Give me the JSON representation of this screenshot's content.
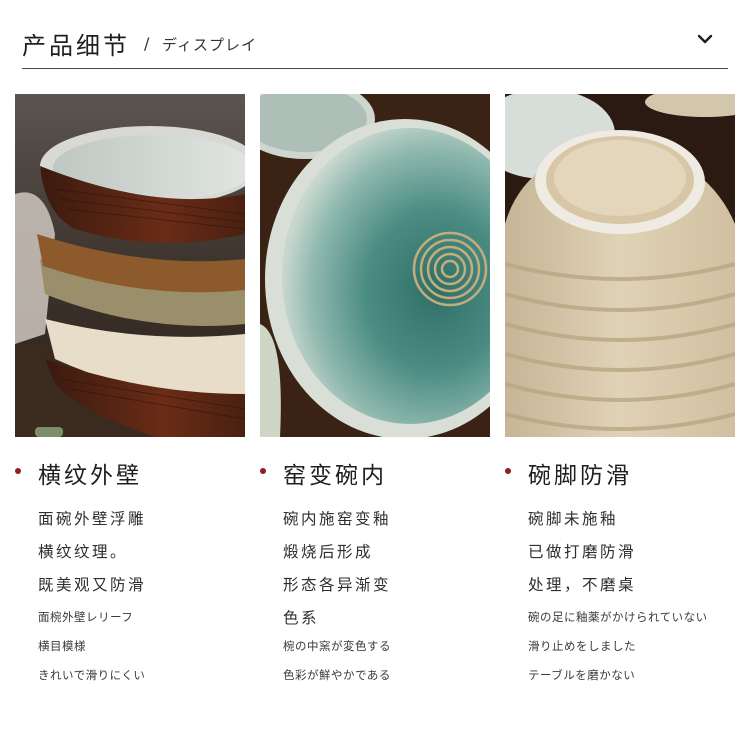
{
  "header": {
    "title_zh": "产品细节",
    "separator": "/",
    "title_ja": "ディスプレイ",
    "toggle_icon": "chevron-down-icon"
  },
  "columns": [
    {
      "heading": "横纹外壁",
      "lines_zh": [
        "面碗外壁浮雕",
        "横纹纹理。",
        "既美观又防滑"
      ],
      "lines_ja": [
        "面椀外壁レリーフ",
        "横目模様",
        "きれいで滑りにくい"
      ]
    },
    {
      "heading": "窑变碗内",
      "lines_zh": [
        "碗内施窑变釉",
        "煅烧后形成",
        "形态各异渐变",
        "色系"
      ],
      "lines_ja": [
        "椀の中窯が変色する",
        "色彩が鮮やかである"
      ]
    },
    {
      "heading": "碗脚防滑",
      "lines_zh": [
        "碗脚未施釉",
        "已做打磨防滑",
        "处理，不磨桌"
      ],
      "lines_ja": [
        "碗の足に釉薬がかけられていない",
        "滑り止めをしました",
        "テーブルを磨かない"
      ]
    }
  ],
  "colors": {
    "accent_dot": "#8f1f1f",
    "rule": "#444444",
    "text": "#2b2b2b"
  }
}
